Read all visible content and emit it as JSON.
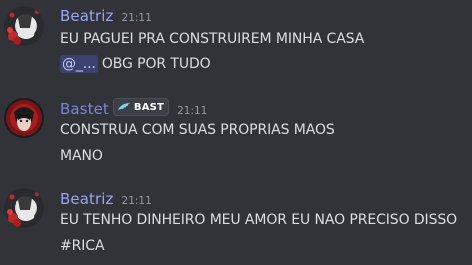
{
  "messages": [
    {
      "author": "Beatriz",
      "author_color": "#9aa4f5",
      "time": "21:11",
      "lines": [
        "EU PAGUEI PRA CONSTRUIREM MINHA CASA",
        "OBG POR TUDO"
      ],
      "mention": "@_..."
    },
    {
      "author": "Bastet",
      "author_color": "#7a84e6",
      "time": "21:11",
      "guild_tag": "BAST",
      "guild_tag_icon": "wing-icon",
      "lines": [
        "CONSTRUA COM SUAS PROPRIAS MAOS",
        "MANO"
      ]
    },
    {
      "author": "Beatriz",
      "author_color": "#9aa4f5",
      "time": "21:11",
      "lines": [
        "EU TENHO DINHEIRO MEU AMOR EU NAO PRECISO DISSO",
        "#RICA"
      ]
    }
  ]
}
